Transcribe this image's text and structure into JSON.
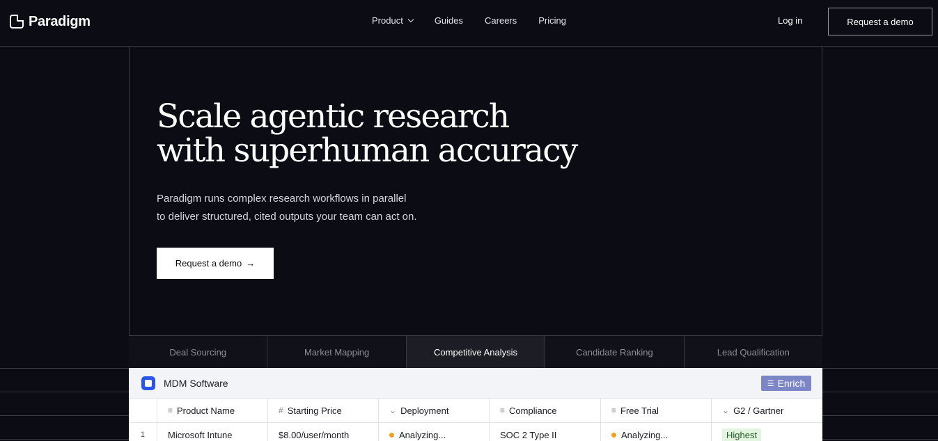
{
  "brand": {
    "name": "Paradigm"
  },
  "nav": {
    "links": [
      "Product",
      "Guides",
      "Careers",
      "Pricing"
    ],
    "login": "Log in",
    "cta": "Request a demo"
  },
  "hero": {
    "title_line1": "Scale agentic research",
    "title_line2": "with superhuman accuracy",
    "subtitle_line1": "Paradigm runs complex research workflows in parallel",
    "subtitle_line2": "to deliver structured, cited outputs your team can act on.",
    "cta": "Request a demo",
    "cta_arrow": "→"
  },
  "tabs": [
    "Deal Sourcing",
    "Market Mapping",
    "Competitive Analysis",
    "Candidate Ranking",
    "Lead Qualification"
  ],
  "active_tab": "Competitive Analysis",
  "table": {
    "title": "MDM Software",
    "enrich_label": "Enrich",
    "columns": [
      {
        "label": "Product Name",
        "icon": "≡"
      },
      {
        "label": "Starting Price",
        "icon": "#"
      },
      {
        "label": "Deployment",
        "icon": "⌄"
      },
      {
        "label": "Compliance",
        "icon": "≡"
      },
      {
        "label": "Free Trial",
        "icon": "≡"
      },
      {
        "label": "G2 / Gartner",
        "icon": "⌄"
      }
    ],
    "rows": [
      {
        "index": "1",
        "product": "Microsoft Intune",
        "price": "$8.00/user/month",
        "deployment": "Analyzing...",
        "compliance": "SOC 2 Type II",
        "free_trial": "Analyzing...",
        "rating": "Highest"
      }
    ]
  },
  "colors": {
    "background": "#0b0c14",
    "accent_blue": "#2a55e6",
    "enrich": "#7c86c7",
    "status_analyzing": "#f0a020",
    "badge_green": "#e3f4e1"
  }
}
